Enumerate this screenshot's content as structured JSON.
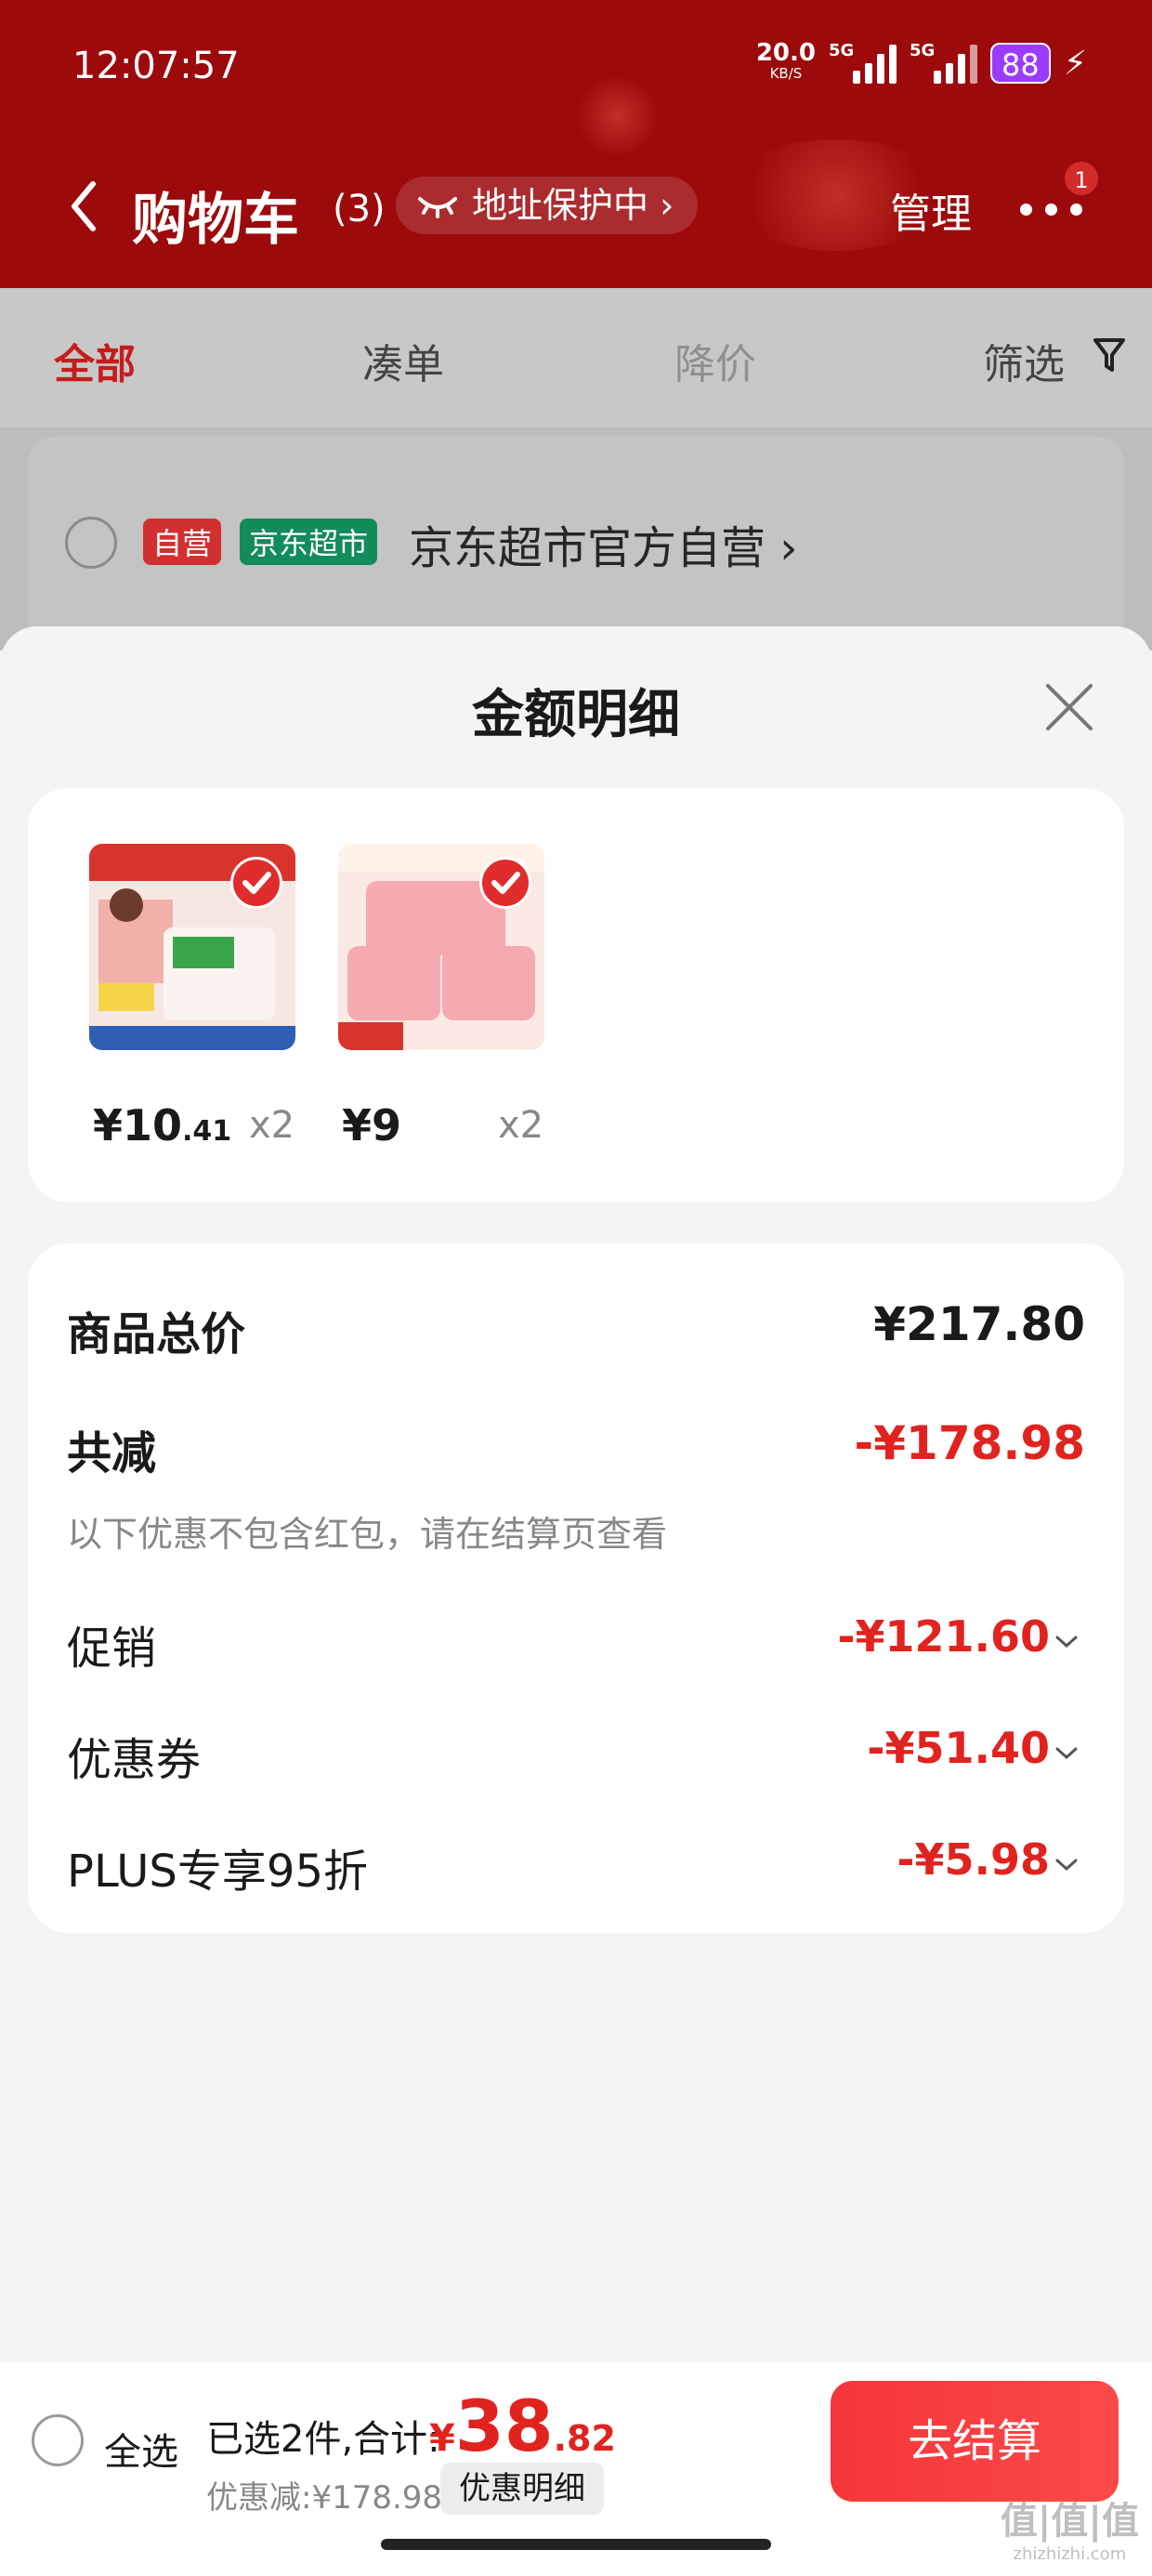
{
  "status_bar": {
    "time": "12:07:57",
    "speed": "20.0",
    "speed_unit": "KB/S",
    "network_1": "5G",
    "network_2": "5G",
    "battery": "88"
  },
  "header": {
    "title": "购物车",
    "count": "(3)",
    "address_protect": "地址保护中 ›",
    "manage": "管理",
    "more_badge": "1"
  },
  "tabs": [
    {
      "label": "全部",
      "active": true
    },
    {
      "label": "凑单",
      "active": false
    },
    {
      "label": "降价",
      "active": false
    },
    {
      "label": "筛选",
      "active": false
    }
  ],
  "shop": {
    "tag_self": "自营",
    "tag_market": "京东超市",
    "name": "京东超市官方自营 ›"
  },
  "sheet": {
    "title": "金额明细",
    "products": [
      {
        "price_main": "¥10",
        "price_decimal": ".41",
        "qty": "x2"
      },
      {
        "price_main": "¥9",
        "price_decimal": "",
        "qty": "x2"
      }
    ],
    "summary": {
      "total_label": "商品总价",
      "total_value": "¥217.80",
      "reduce_label": "共减",
      "reduce_value": "-¥178.98",
      "note": "以下优惠不包含红包，请在结算页查看",
      "items": [
        {
          "label": "促销",
          "value": "-¥121.60"
        },
        {
          "label": "优惠券",
          "value": "-¥51.40"
        },
        {
          "label": "PLUS专享95折",
          "value": "-¥5.98"
        }
      ]
    }
  },
  "bottom_bar": {
    "select_all": "全选",
    "selected": "已选2件,合计:",
    "total_yen": "¥",
    "total_main": "38",
    "total_decimal": ".82",
    "saved": "优惠减:¥178.98",
    "detail_button": "优惠明细",
    "checkout": "去结算"
  },
  "watermark": {
    "main": "值|值|值",
    "sub": "zhizhizhi.com"
  },
  "colors": {
    "header_red": "#9c0a0c",
    "accent_red": "#e0231f",
    "battery_purple": "#9b3bff"
  }
}
